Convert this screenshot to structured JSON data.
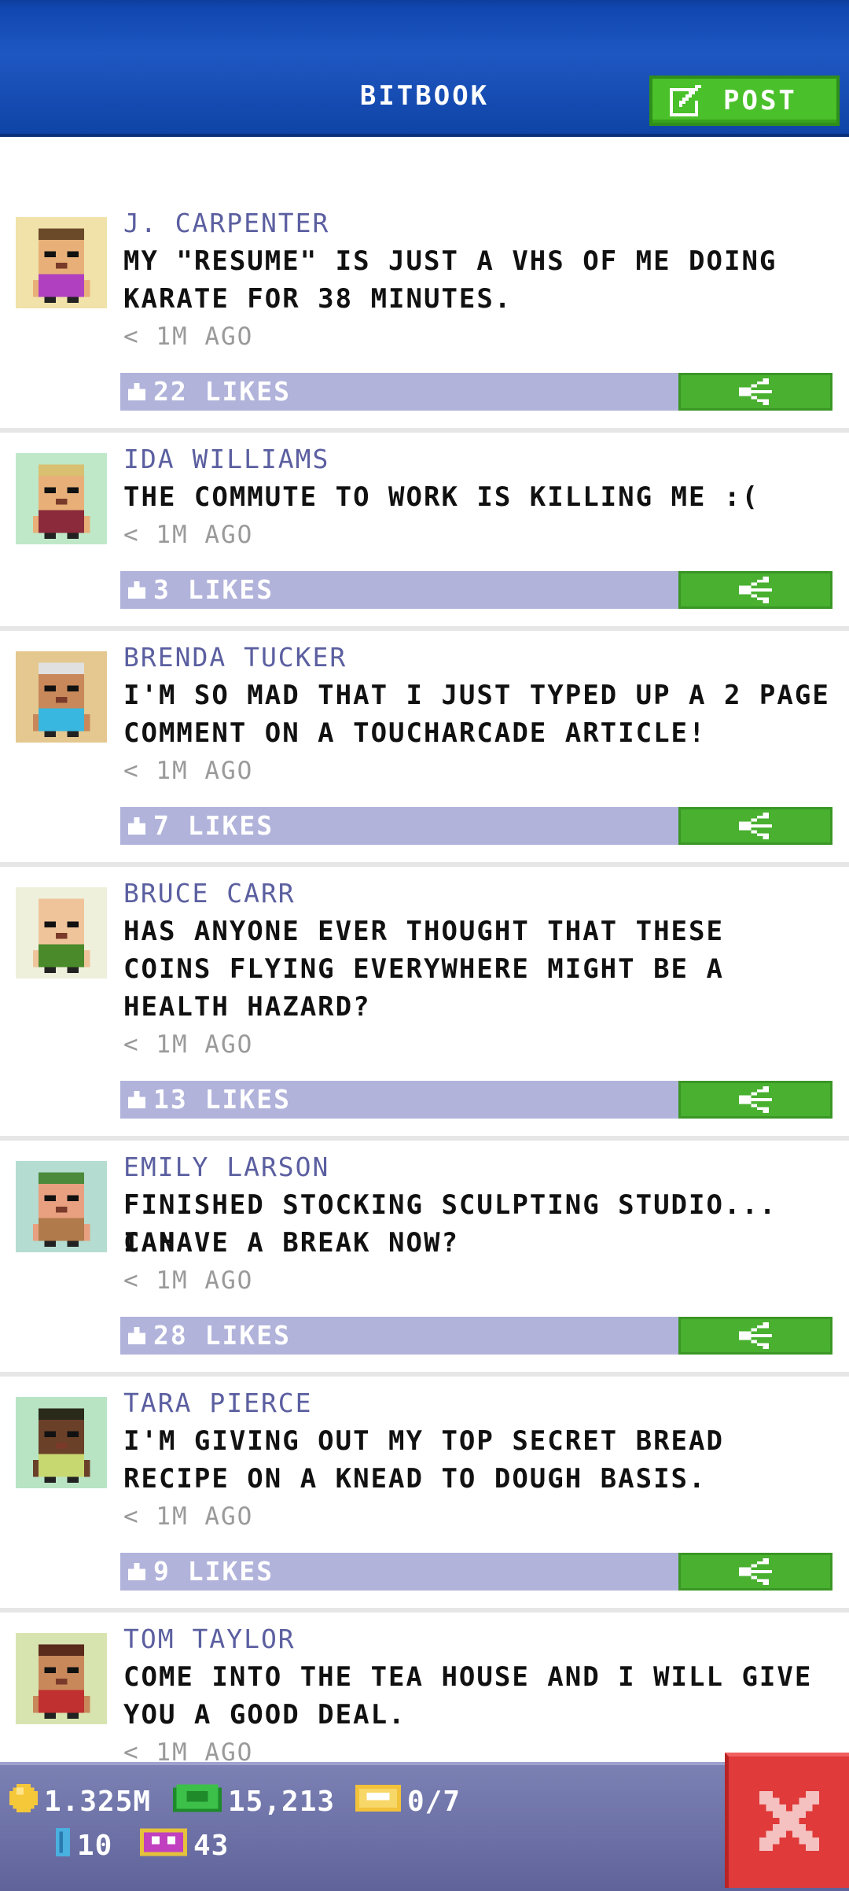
{
  "header": {
    "title": "BITBOOK",
    "post_label": "POST",
    "post_icon": "edit-icon",
    "colors": {
      "header": "#1f57c2",
      "post_button": "#4ac02a"
    }
  },
  "feed": {
    "posts": [
      {
        "name": "J. CARPENTER",
        "lines": [
          "MY \"RESUME\" IS JUST A VHS OF ME DOING",
          "KARATE FOR 38 MINUTES."
        ],
        "time": "1M AGO",
        "likes": "22 LIKES",
        "avatar_bg": "#f0e2a8",
        "skin": "#e8b078",
        "hair": "#6b4a2a",
        "shirt": "#b040c0"
      },
      {
        "name": "IDA WILLIAMS",
        "lines": [
          "THE COMMUTE TO WORK IS KILLING ME :("
        ],
        "time": "1M AGO",
        "likes": "3 LIKES",
        "avatar_bg": "#bfe8c8",
        "skin": "#e8b078",
        "hair": "#d8c070",
        "shirt": "#8a2a3a"
      },
      {
        "name": "BRENDA TUCKER",
        "lines": [
          "I'M SO MAD THAT I JUST TYPED UP A 2 PAGE",
          "COMMENT ON A TOUCHARCADE ARTICLE!"
        ],
        "time": "1M AGO",
        "likes": "7 LIKES",
        "avatar_bg": "#e4c890",
        "skin": "#c8885a",
        "hair": "#e0e0e0",
        "shirt": "#38b8e0"
      },
      {
        "name": "BRUCE CARR",
        "lines": [
          "HAS ANYONE EVER THOUGHT THAT THESE",
          "COINS FLYING EVERYWHERE MIGHT BE A",
          "HEALTH HAZARD?"
        ],
        "time": "1M AGO",
        "likes": "13 LIKES",
        "avatar_bg": "#eef0dc",
        "skin": "#f0c49a",
        "hair": "#f0c49a",
        "shirt": "#4a8a2a"
      },
      {
        "name": "EMILY LARSON",
        "lines": [
          "FINISHED STOCKING SCULPTING STUDIO... CAN",
          "I HAVE A BREAK NOW?"
        ],
        "time": "1M AGO",
        "likes": "28 LIKES",
        "avatar_bg": "#b4dcd0",
        "skin": "#e8a080",
        "hair": "#4a8a3a",
        "shirt": "#b07a4a"
      },
      {
        "name": "TARA PIERCE",
        "lines": [
          "I'M GIVING OUT MY TOP SECRET BREAD",
          "RECIPE ON A KNEAD TO DOUGH BASIS."
        ],
        "time": "1M AGO",
        "likes": "9 LIKES",
        "avatar_bg": "#b8e4c4",
        "skin": "#6a4028",
        "hair": "#2a2a1a",
        "shirt": "#c8d870"
      },
      {
        "name": "TOM TAYLOR",
        "lines": [
          "COME INTO THE TEA HOUSE AND I WILL GIVE",
          "YOU A GOOD DEAL."
        ],
        "time": "1M AGO",
        "likes": "",
        "avatar_bg": "#d8e4b0",
        "skin": "#c8885a",
        "hair": "#5a2a1a",
        "shirt": "#c03030"
      }
    ]
  },
  "bottom_bar": {
    "coins": "1.325M",
    "bux": "15,213",
    "tickets": "0/7",
    "floors": "10",
    "vip": "43",
    "icons": [
      "coin-icon",
      "bux-icon",
      "ticket-icon",
      "floor-icon",
      "vip-icon",
      "close-icon"
    ]
  }
}
